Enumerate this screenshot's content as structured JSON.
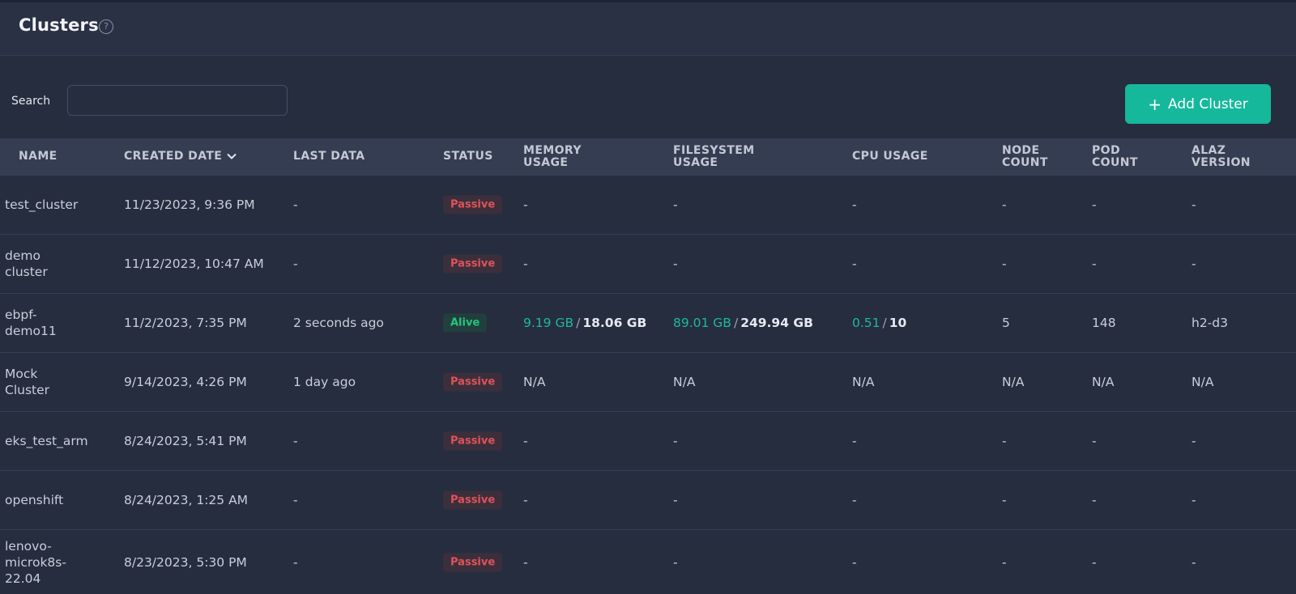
{
  "header": {
    "title": "Clusters",
    "help_icon": "?"
  },
  "toolbar": {
    "search_label": "Search",
    "search_value": "",
    "add_label": "Add Cluster",
    "add_icon": "+"
  },
  "columns": {
    "name": "NAME",
    "created": "CREATED DATE",
    "last_data": "LAST DATA",
    "status": "STATUS",
    "memory_1": "MEMORY",
    "memory_2": "USAGE",
    "fs_1": "FILESYSTEM",
    "fs_2": "USAGE",
    "cpu": "CPU USAGE",
    "node_1": "NODE",
    "node_2": "COUNT",
    "pod_1": "POD",
    "pod_2": "COUNT",
    "alaz_1": "ALAZ",
    "alaz_2": "VERSION"
  },
  "rows": [
    {
      "name": "test_cluster",
      "created": "11/23/2023, 9:36 PM",
      "last_data": "-",
      "status": "Passive",
      "memory": "-",
      "fs": "-",
      "cpu": "-",
      "node": "-",
      "pod": "-",
      "alaz": "-"
    },
    {
      "name": "demo cluster",
      "created": "11/12/2023, 10:47 AM",
      "last_data": "-",
      "status": "Passive",
      "memory": "-",
      "fs": "-",
      "cpu": "-",
      "node": "-",
      "pod": "-",
      "alaz": "-"
    },
    {
      "name": "ebpf-demo11",
      "created": "11/2/2023, 7:35 PM",
      "last_data": "2 seconds ago",
      "status": "Alive",
      "memory_used": "9.19 GB",
      "memory_total": "18.06 GB",
      "fs_used": "89.01 GB",
      "fs_total": "249.94 GB",
      "cpu_used": "0.51",
      "cpu_total": "10",
      "node": "5",
      "pod": "148",
      "alaz": "h2-d3",
      "sep": "/"
    },
    {
      "name": "Mock Cluster",
      "created": "9/14/2023, 4:26 PM",
      "last_data": "1 day ago",
      "status": "Passive",
      "memory": "N/A",
      "fs": "N/A",
      "cpu": "N/A",
      "node": "N/A",
      "pod": "N/A",
      "alaz": "N/A"
    },
    {
      "name": "eks_test_arm",
      "created": "8/24/2023, 5:41 PM",
      "last_data": "-",
      "status": "Passive",
      "memory": "-",
      "fs": "-",
      "cpu": "-",
      "node": "-",
      "pod": "-",
      "alaz": "-"
    },
    {
      "name": "openshift",
      "created": "8/24/2023, 1:25 AM",
      "last_data": "-",
      "status": "Passive",
      "memory": "-",
      "fs": "-",
      "cpu": "-",
      "node": "-",
      "pod": "-",
      "alaz": "-"
    },
    {
      "name": "lenovo-microk8s-22.04",
      "created": "8/23/2023, 5:30 PM",
      "last_data": "-",
      "status": "Passive",
      "memory": "-",
      "fs": "-",
      "cpu": "-",
      "node": "-",
      "pod": "-",
      "alaz": "-"
    }
  ],
  "colors": {
    "accent": "#15b89a",
    "passive": "#e0525a",
    "alive": "#22c77d"
  }
}
